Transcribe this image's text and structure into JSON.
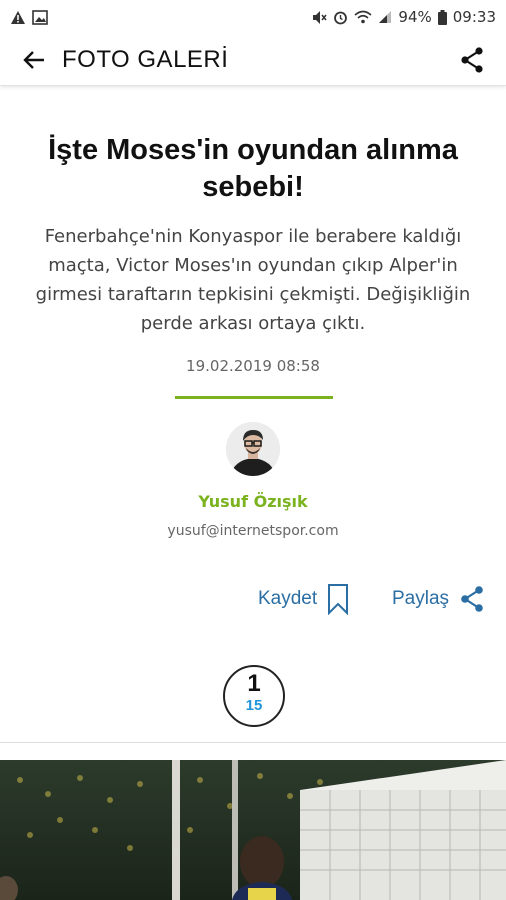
{
  "status_bar": {
    "battery": "94%",
    "time": "09:33"
  },
  "app_bar": {
    "title": "FOTO GALERİ"
  },
  "article": {
    "headline": "İşte Moses'in oyundan alınma sebebi!",
    "summary": "Fenerbahçe'nin Konyaspor ile berabere kaldığı maçta, Victor Moses'ın oyundan çıkıp Alper'in girmesi taraftarın tepkisini çekmişti. Değişikliğin perde arkası ortaya çıktı.",
    "date": "19.02.2019 08:58"
  },
  "author": {
    "name": "Yusuf Özışık",
    "email": "yusuf@internetspor.com"
  },
  "actions": {
    "save_label": "Kaydet",
    "share_label": "Paylaş"
  },
  "gallery": {
    "current_page": "1",
    "total_pages": "15"
  },
  "colors": {
    "accent_green": "#7ab31f",
    "link_blue": "#2b6ea3",
    "page_total_blue": "#1f95d8"
  },
  "icons": {
    "back": "back-arrow-icon",
    "share": "share-icon",
    "bookmark": "bookmark-icon"
  }
}
